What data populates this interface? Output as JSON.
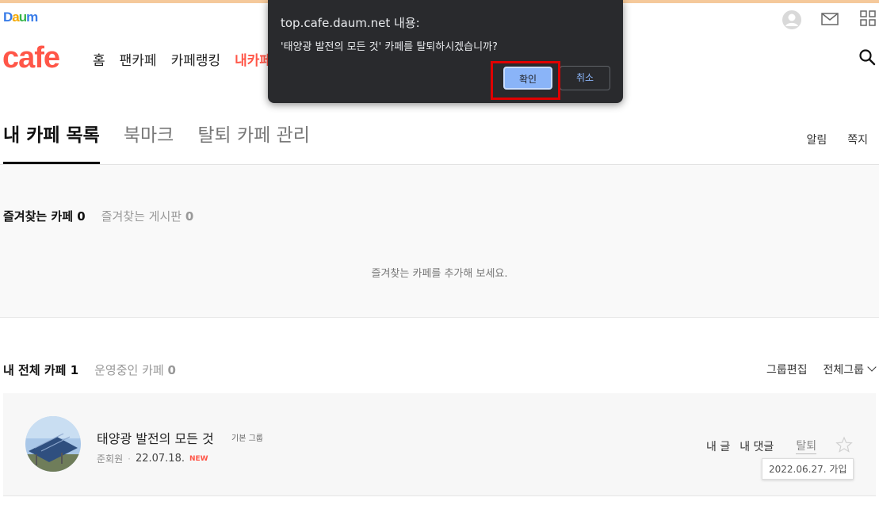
{
  "header": {
    "daum_logo": {
      "letters": [
        "D",
        "a",
        "u",
        "m"
      ],
      "colors": [
        "#3a7de8",
        "#f5a800",
        "#39b54a",
        "#3a7de8"
      ]
    },
    "cafe_logo": "cafe",
    "nav": [
      "홈",
      "팬카페",
      "카페랭킹",
      "내카페"
    ],
    "active_nav_index": 3,
    "icons": [
      "profile-icon",
      "mail-icon",
      "app-grid-icon",
      "search-icon"
    ]
  },
  "tabs": {
    "items": [
      "내 카페 목록",
      "북마크",
      "탈퇴 카페 관리"
    ],
    "active_index": 0,
    "right_links": [
      "알림",
      "쪽지"
    ]
  },
  "favorites": {
    "tab_cafe": "즐겨찾는 카페",
    "tab_cafe_count": "0",
    "tab_board": "즐겨찾는 게시판",
    "tab_board_count": "0",
    "empty_message": "즐겨찾는 카페를 추가해 보세요."
  },
  "all_cafes": {
    "tab_all": "내 전체 카페",
    "tab_all_count": "1",
    "tab_managed": "운영중인 카페",
    "tab_managed_count": "0",
    "group_edit": "그룹편집",
    "group_select": "전체그룹"
  },
  "cafe_item": {
    "name": "태양광 발전의 모든 것",
    "group": "기본 그룹",
    "member_grade": "준회원",
    "date": "22.07.18.",
    "new_badge": "NEW",
    "action_posts": "내 글",
    "action_comments": "내 댓글",
    "action_leave": "탈퇴",
    "join_tooltip": "2022.06.27. 가입"
  },
  "dialog": {
    "title": "top.cafe.daum.net 내용:",
    "message": "'태양광 발전의 모든 것' 카페를 탈퇴하시겠습니까?",
    "ok_label": "확인",
    "cancel_label": "취소"
  },
  "colors": {
    "brand_red": "#ff5648",
    "dialog_bg": "#292a2d",
    "dialog_primary": "#8ab4f8",
    "highlight_box": "#e00000"
  }
}
